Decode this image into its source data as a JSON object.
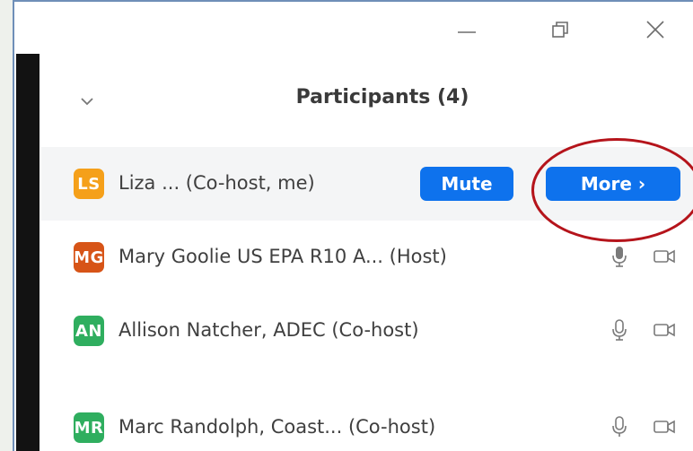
{
  "window": {
    "minimize_icon": "minimize-icon",
    "restore_icon": "restore-icon",
    "close_icon": "close-icon"
  },
  "header": {
    "collapse_icon": "chevron-down-icon",
    "title": "Participants (4)"
  },
  "participants": [
    {
      "initials": "LS",
      "avatar_color": "#f5a01a",
      "name": "Liza ...  (Co-host, me)",
      "mute_label": "Mute",
      "more_label": "More ›"
    },
    {
      "initials": "MG",
      "avatar_color": "#d75417",
      "name": "Mary Goolie US EPA R10 A... (Host)"
    },
    {
      "initials": "AN",
      "avatar_color": "#2fae5f",
      "name": "Allison Natcher, ADEC (Co-host)"
    },
    {
      "initials": "MR",
      "avatar_color": "#2fae5f",
      "name": "Marc Randolph, Coast... (Co-host)"
    }
  ],
  "colors": {
    "accent": "#0e72ed",
    "annotation": "#b5141b"
  }
}
